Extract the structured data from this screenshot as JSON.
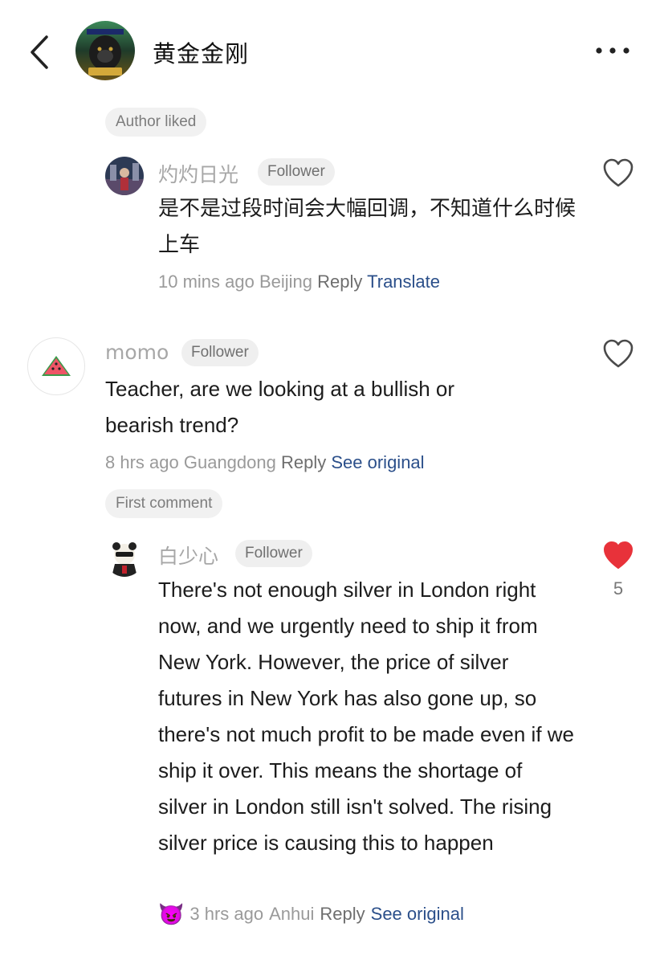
{
  "header": {
    "title": "黄金金刚",
    "avatar_icon": "gorilla-avatar-icon",
    "back_icon": "chevron-left-icon",
    "more_icon": "more-horizontal-icon"
  },
  "comments": [
    {
      "tag": "Author liked",
      "username": "灼灼日光",
      "badge": "Follower",
      "text": "是不是过段时间会大幅回调，不知道什么时候上车",
      "time": "10 mins ago",
      "location": "Beijing",
      "reply_label": "Reply",
      "action_label": "Translate",
      "liked": false
    },
    {
      "username": "momo",
      "badge": "Follower",
      "text": "Teacher, are we looking at a bullish or bearish trend?",
      "time": "8 hrs ago",
      "location": "Guangdong",
      "reply_label": "Reply",
      "action_label": "See original",
      "avatar_icon": "watermelon-icon",
      "liked": false
    },
    {
      "tag": "First comment",
      "username": "白少心",
      "badge": "Follower",
      "text": "There's not enough silver in London right now, and we urgently need to ship it from New York. However, the price of silver futures in New York has also gone up, so there's not much profit to be made even if we ship it over. This means the shortage of silver in London still isn't solved. The rising silver price is causing this to happen",
      "emoji": "😈",
      "time": "3 hrs ago",
      "location": "Anhui",
      "reply_label": "Reply",
      "action_label": "See original",
      "liked": true,
      "like_count": "5"
    }
  ],
  "colors": {
    "link": "#2b4f8a",
    "heart_active": "#e8323a",
    "tag_bg": "#f1f1f1"
  }
}
